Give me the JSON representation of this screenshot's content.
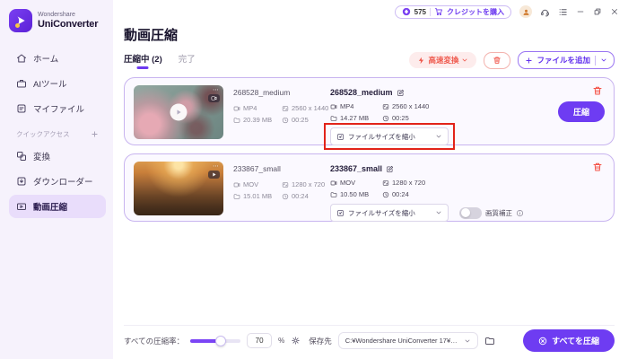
{
  "app": {
    "brand_top": "Wondershare",
    "brand_bottom": "UniConverter"
  },
  "header": {
    "credits": "575",
    "buy_credits": "クレジットを購入"
  },
  "sidebar": {
    "items": [
      {
        "label": "ホーム",
        "icon": "home-icon"
      },
      {
        "label": "AIツール",
        "icon": "briefcase-icon"
      },
      {
        "label": "マイファイル",
        "icon": "file-icon"
      }
    ],
    "quick_access_label": "クイックアクセス",
    "quick_items": [
      {
        "label": "変換",
        "icon": "convert-icon"
      },
      {
        "label": "ダウンローダー",
        "icon": "downloader-icon"
      },
      {
        "label": "動画圧縮",
        "icon": "video-compress-icon",
        "active": true
      }
    ]
  },
  "main": {
    "title": "動画圧縮",
    "tabs": [
      {
        "label": "圧縮中 (2)",
        "active": true
      },
      {
        "label": "完了",
        "active": false
      }
    ],
    "actions": {
      "fast_convert": "高速変換",
      "add_files": "ファイルを追加"
    },
    "rows": [
      {
        "source": {
          "name": "268528_medium",
          "format": "MP4",
          "resolution": "2560 x 1440",
          "size": "20.39 MB",
          "duration": "00:25"
        },
        "target": {
          "name": "268528_medium",
          "format": "MP4",
          "resolution": "2560 x 1440",
          "size": "14.27 MB",
          "duration": "00:25"
        },
        "mode": "ファイルサイズを縮小",
        "compress_label": "圧縮",
        "highlighted": true
      },
      {
        "source": {
          "name": "233867_small",
          "format": "MOV",
          "resolution": "1280 x 720",
          "size": "15.01 MB",
          "duration": "00:24"
        },
        "target": {
          "name": "233867_small",
          "format": "MOV",
          "resolution": "1280 x 720",
          "size": "10.50 MB",
          "duration": "00:24"
        },
        "mode": "ファイルサイズを縮小",
        "quality_toggle_label": "画質補正",
        "quality_toggle_on": false
      }
    ],
    "footer": {
      "rate_label": "すべての圧縮率：",
      "rate_value": "70",
      "percent_sign": "%",
      "save_label": "保存先",
      "save_path": "C:¥Wondershare UniConverter 17¥Compres",
      "compress_all": "すべてを圧縮"
    }
  },
  "colors": {
    "accent": "#6e3cf2",
    "danger": "#f1453c",
    "highlight_box": "#e2231a",
    "sidebar_bg": "#f6f2fc",
    "sidebar_active_bg": "#e9ddfb",
    "card_bg": "#fbf9ff",
    "card_border": "#c8b4ef",
    "fast_convert_bg": "#fdecec",
    "fast_convert_text": "#ef5a4e"
  }
}
